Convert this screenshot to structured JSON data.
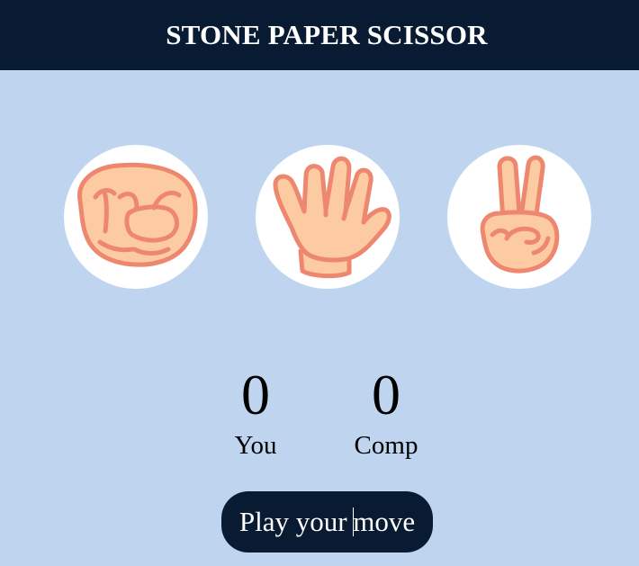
{
  "header": {
    "title": "STONE PAPER SCISSOR"
  },
  "choices": [
    {
      "id": "rock",
      "icon": "fist-hand-icon"
    },
    {
      "id": "paper",
      "icon": "open-hand-icon"
    },
    {
      "id": "scissors",
      "icon": "peace-sign-hand-icon"
    }
  ],
  "scoreboard": {
    "user": {
      "score": "0",
      "label": "You"
    },
    "comp": {
      "score": "0",
      "label": "Comp"
    }
  },
  "message": {
    "before_cursor": "Play your ",
    "after_cursor": "move"
  },
  "colors": {
    "header_bg": "#081B33",
    "page_bg": "#BFD5EF",
    "skin": "#FDCBA2",
    "outline": "#EE8770"
  }
}
